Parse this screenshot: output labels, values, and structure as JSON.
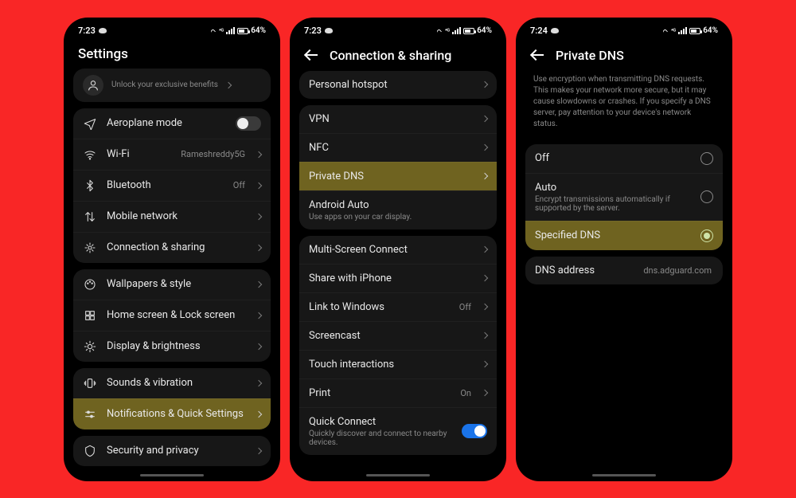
{
  "status": {
    "time1": "7:23",
    "time2": "7:23",
    "time3": "7:24",
    "battery": "64%"
  },
  "p1": {
    "title": "Settings",
    "banner_sub": "Unlock your exclusive benefits",
    "g1": {
      "aeroplane": "Aeroplane mode",
      "wifi": "Wi-Fi",
      "wifi_val": "Rameshreddy5G",
      "bt": "Bluetooth",
      "bt_val": "Off",
      "mobile": "Mobile network",
      "conn": "Connection & sharing"
    },
    "g2": {
      "wall": "Wallpapers & style",
      "home": "Home screen & Lock screen",
      "disp": "Display & brightness"
    },
    "g3": {
      "sound": "Sounds & vibration",
      "notif": "Notifications & Quick Settings"
    },
    "g4": {
      "sec": "Security and privacy"
    }
  },
  "p2": {
    "title": "Connection & sharing",
    "hotspot": "Personal hotspot",
    "g1": {
      "vpn": "VPN",
      "nfc": "NFC",
      "pdns": "Private DNS",
      "aa": "Android Auto",
      "aa_sub": "Use apps on your car display."
    },
    "g2": {
      "ms": "Multi-Screen Connect",
      "share": "Share with iPhone",
      "link": "Link to Windows",
      "link_val": "Off",
      "cast": "Screencast",
      "touch": "Touch interactions",
      "print": "Print",
      "print_val": "On",
      "qc": "Quick Connect",
      "qc_sub": "Quickly discover and connect to nearby devices."
    }
  },
  "p3": {
    "title": "Private DNS",
    "desc": "Use encryption when transmitting DNS requests. This makes your network more secure, but it may cause slowdowns or crashes. If you specify a DNS server, pay attention to your device's network status.",
    "off": "Off",
    "auto": "Auto",
    "auto_sub": "Encrypt transmissions automatically if supported by the server.",
    "spec": "Specified DNS",
    "addr_label": "DNS address",
    "addr_val": "dns.adguard.com"
  }
}
